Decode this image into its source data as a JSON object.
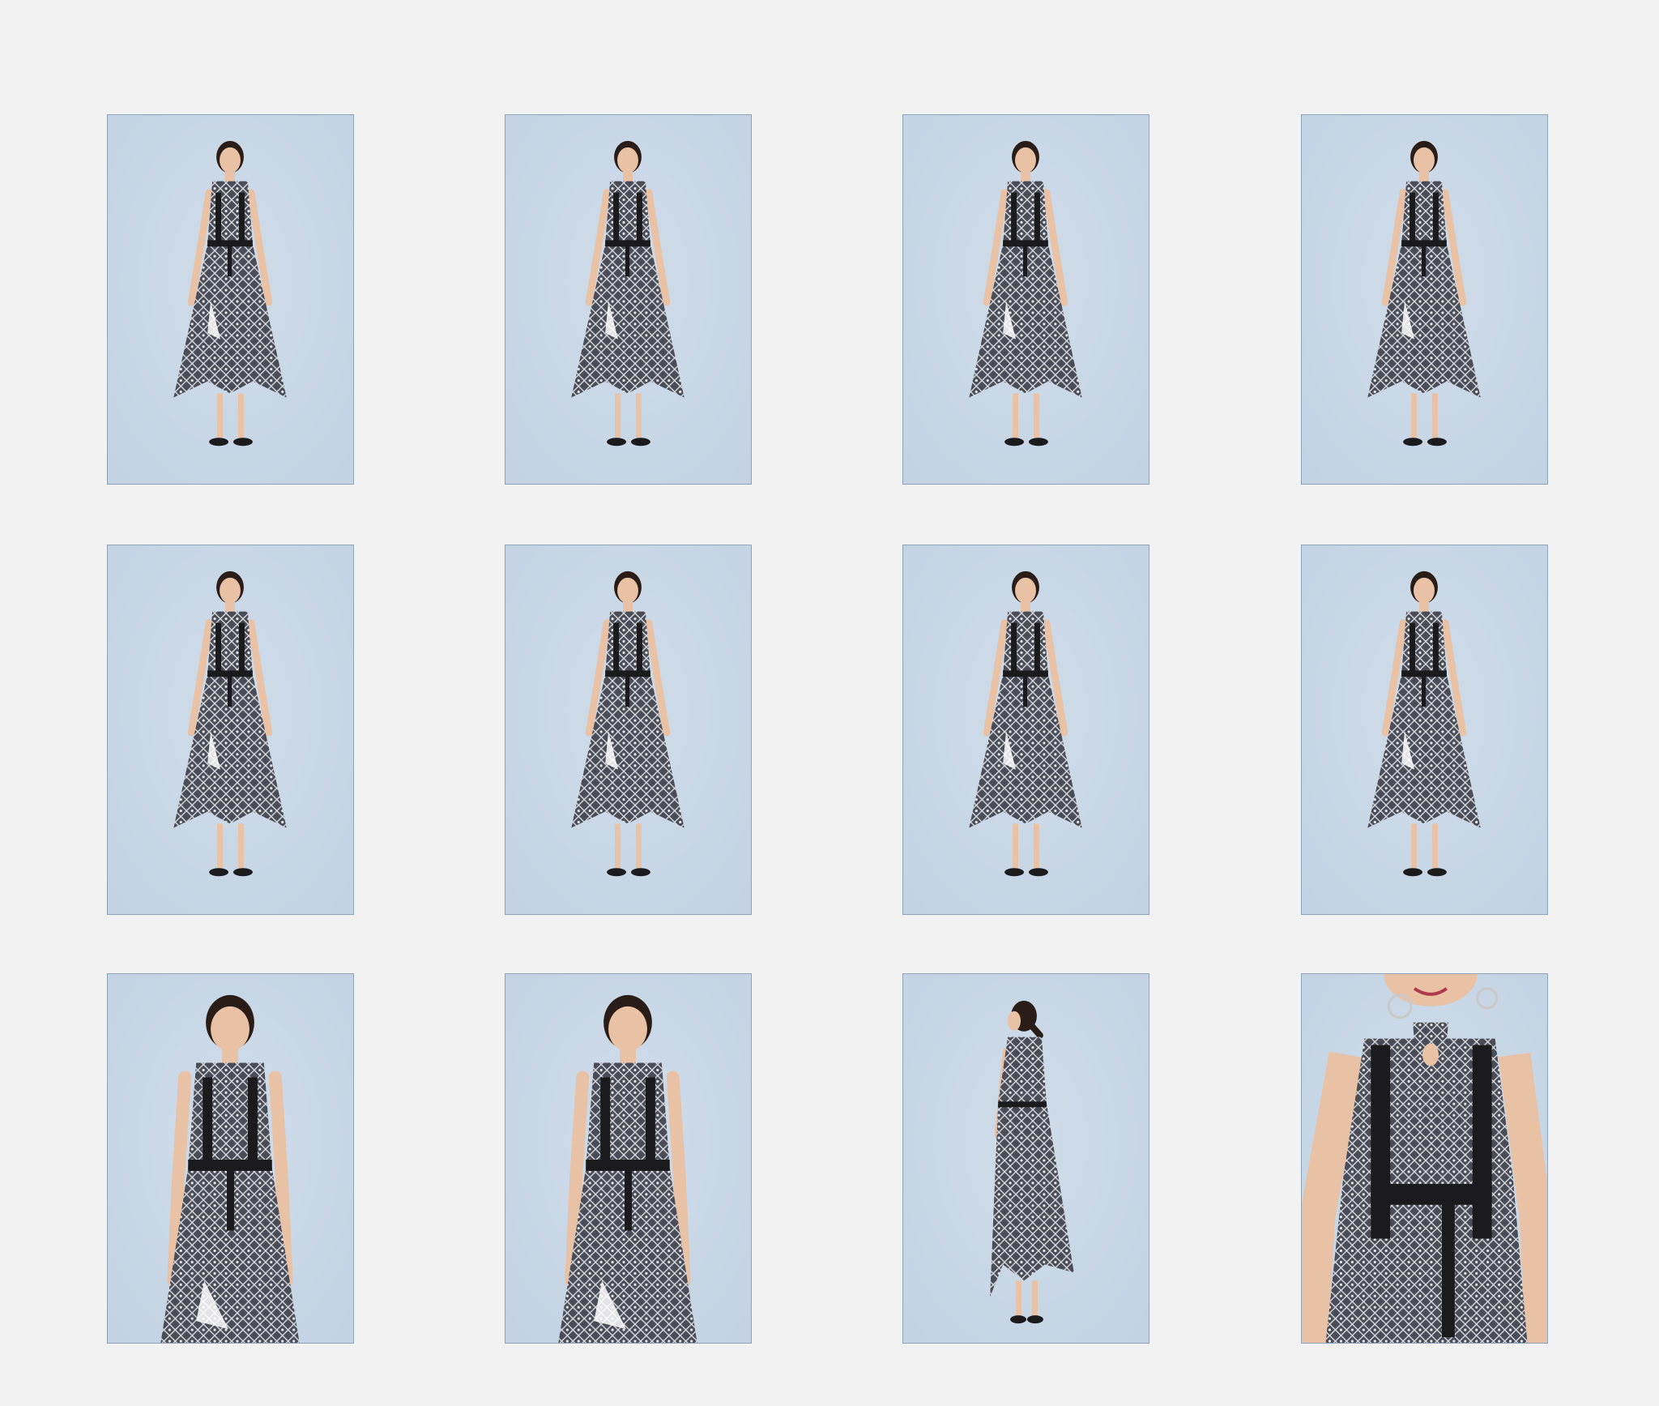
{
  "gallery": {
    "background_color": "#f2f2f2",
    "backdrop_color": "#c3d3e3",
    "dress_color": "#4a4d57",
    "accent_color": "#1b1b1e",
    "skin_color": "#e9c2a6",
    "hair_color": "#2a1d17",
    "photos": [
      {
        "pose": "full-body-front-skirt-held-out"
      },
      {
        "pose": "full-body-front-skirt-spread"
      },
      {
        "pose": "full-body-walking-skirt-lifted"
      },
      {
        "pose": "full-body-front-standing"
      },
      {
        "pose": "full-body-front-hands-at-waist"
      },
      {
        "pose": "full-body-walking-step"
      },
      {
        "pose": "full-body-walking-step-2"
      },
      {
        "pose": "full-body-front-three-quarter"
      },
      {
        "pose": "three-quarter-front"
      },
      {
        "pose": "three-quarter-hand-on-chest"
      },
      {
        "pose": "full-body-back-view"
      },
      {
        "pose": "bodice-close-up"
      }
    ]
  }
}
